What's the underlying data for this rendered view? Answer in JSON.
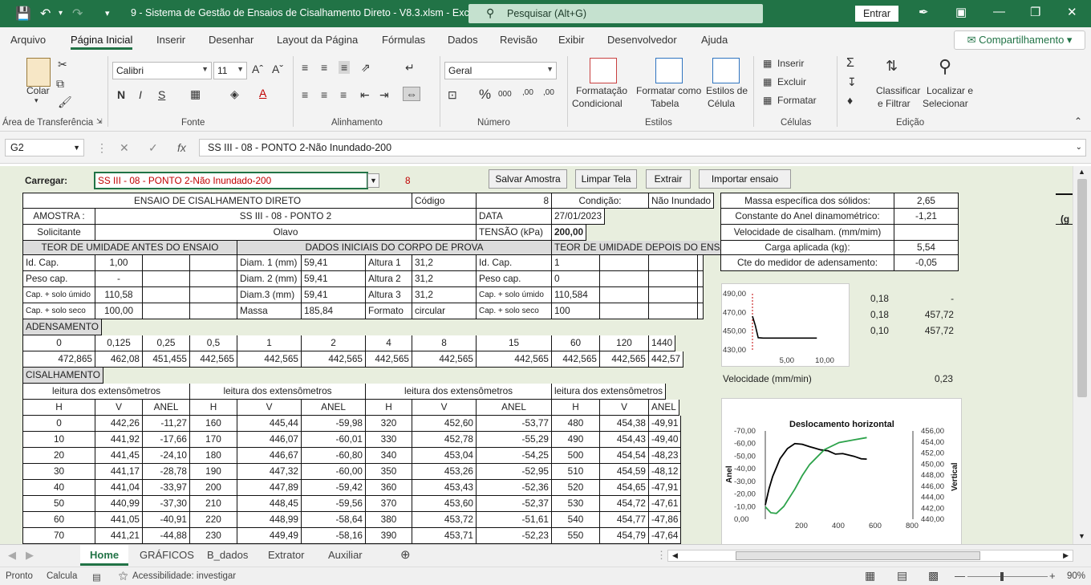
{
  "titlebar": {
    "title": "9 - Sistema de Gestão de Ensaios de Cisalhamento Direto - V8.3.xlsm  -  Excel",
    "search": "Pesquisar (Alt+G)",
    "entrar": "Entrar"
  },
  "menu": {
    "items": [
      "Arquivo",
      "Página Inicial",
      "Inserir",
      "Desenhar",
      "Layout da Página",
      "Fórmulas",
      "Dados",
      "Revisão",
      "Exibir",
      "Desenvolvedor",
      "Ajuda"
    ],
    "share": "Compartilhamento"
  },
  "ribbon": {
    "clipboard": {
      "label": "Área de Transferência",
      "colar": "Colar"
    },
    "font": {
      "label": "Fonte",
      "name": "Calibri",
      "size": "11"
    },
    "alignment": {
      "label": "Alinhamento"
    },
    "number": {
      "label": "Número",
      "format": "Geral"
    },
    "styles": {
      "label": "Estilos",
      "cond1": "Formatação",
      "cond2": "Condicional",
      "table1": "Formatar como",
      "table2": "Tabela",
      "cell1": "Estilos de",
      "cell2": "Célula"
    },
    "cells": {
      "label": "Células",
      "insert": "Inserir",
      "delete": "Excluir",
      "format": "Formatar"
    },
    "editing": {
      "label": "Edição",
      "sort1": "Classificar",
      "sort2": "e Filtrar",
      "find1": "Localizar e",
      "find2": "Selecionar"
    }
  },
  "formula_bar": {
    "name_box": "G2",
    "content": "SS III - 08 - PONTO 2-Não Inundado-200"
  },
  "sheet": {
    "carregar_label": "Carregar:",
    "carregar_value": "SS III - 08 - PONTO 2-Não Inundado-200",
    "carregar_num": "8",
    "buttons": [
      "Salvar Amostra",
      "Limpar Tela",
      "Extrair",
      "Importar ensaio"
    ],
    "header": {
      "title": "ENSAIO DE CISALHAMENTO DIRETO",
      "codigo_label": "Código",
      "codigo": "8",
      "condicao_label": "Condição:",
      "condicao": "Não Inundado",
      "amostra_label": "AMOSTRA :",
      "amostra": "SS III - 08 - PONTO 2",
      "data_label": "DATA",
      "data": "27/01/2023",
      "solicitante_label": "Solicitante",
      "solicitante": "Olavo",
      "tensao_label": "TENSÃO (kPa)",
      "tensao": "200,00"
    },
    "sections": {
      "umid_antes": "TEOR DE UMIDADE ANTES DO ENSAIO",
      "dados_iniciais": "DADOS INICIAIS DO CORPO DE PROVA",
      "umid_depois": "TEOR DE UMIDADE DEPOIS DO ENSAIO",
      "adensamento": "ADENSAMENTO",
      "cisalhamento": "CISALHAMENTO"
    },
    "umid_antes": [
      [
        "Id. Cap.",
        "1,00"
      ],
      [
        "Peso cap.",
        "-"
      ],
      [
        "Cap. + solo úmido",
        "110,58"
      ],
      [
        "Cap. + solo seco",
        "100,00"
      ]
    ],
    "dados_iniciais": [
      [
        "Diam. 1 (mm)",
        "59,41",
        "Altura 1",
        "31,2"
      ],
      [
        "Diam. 2 (mm)",
        "59,41",
        "Altura 2",
        "31,2"
      ],
      [
        "Diam.3 (mm)",
        "59,41",
        "Altura 3",
        "31,2"
      ],
      [
        "Massa",
        "185,84",
        "Formato",
        "circular"
      ]
    ],
    "umid_depois": [
      [
        "Id. Cap.",
        "1"
      ],
      [
        "Peso cap.",
        "0"
      ],
      [
        "Cap. + solo úmido",
        "110,584"
      ],
      [
        "Cap. + solo seco",
        "100"
      ]
    ],
    "adens_times": [
      "0",
      "0,125",
      "0,25",
      "0,5",
      "1",
      "2",
      "4",
      "8",
      "15",
      "60",
      "120",
      "1440"
    ],
    "adens_values": [
      "472,865",
      "462,08",
      "451,455",
      "442,565",
      "442,565",
      "442,565",
      "442,565",
      "442,565",
      "442,565",
      "442,565",
      "442,565",
      "442,57"
    ],
    "cis_group_header": "leitura dos extensômetros",
    "cis_cols": [
      "H",
      "V",
      "ANEL"
    ],
    "cis_rows": [
      [
        "0",
        "442,26",
        "-11,27",
        "160",
        "445,44",
        "-59,98",
        "320",
        "452,60",
        "-53,77",
        "480",
        "454,38",
        "-49,91"
      ],
      [
        "10",
        "441,92",
        "-17,66",
        "170",
        "446,07",
        "-60,01",
        "330",
        "452,78",
        "-55,29",
        "490",
        "454,43",
        "-49,40"
      ],
      [
        "20",
        "441,45",
        "-24,10",
        "180",
        "446,67",
        "-60,80",
        "340",
        "453,04",
        "-54,25",
        "500",
        "454,54",
        "-48,23"
      ],
      [
        "30",
        "441,17",
        "-28,78",
        "190",
        "447,32",
        "-60,00",
        "350",
        "453,26",
        "-52,95",
        "510",
        "454,59",
        "-48,12"
      ],
      [
        "40",
        "441,04",
        "-33,97",
        "200",
        "447,89",
        "-59,42",
        "360",
        "453,43",
        "-52,36",
        "520",
        "454,65",
        "-47,91"
      ],
      [
        "50",
        "440,99",
        "-37,30",
        "210",
        "448,45",
        "-59,56",
        "370",
        "453,60",
        "-52,37",
        "530",
        "454,72",
        "-47,61"
      ],
      [
        "60",
        "441,05",
        "-40,91",
        "220",
        "448,99",
        "-58,64",
        "380",
        "453,72",
        "-51,61",
        "540",
        "454,77",
        "-47,86"
      ],
      [
        "70",
        "441,21",
        "-44,88",
        "230",
        "449,49",
        "-58,16",
        "390",
        "453,71",
        "-52,23",
        "550",
        "454,79",
        "-47,64"
      ]
    ],
    "params": [
      [
        "Massa específica dos sólidos:",
        "2,65"
      ],
      [
        "Constante do Anel dinamométrico:",
        "-1,21"
      ],
      [
        "Velocidade de cisalham. (mm/mim)",
        ""
      ],
      [
        "Carga aplicada (kg):",
        "5,54"
      ],
      [
        "Cte do medidor de adensamento:",
        "-0,05"
      ]
    ],
    "side_values": [
      [
        "0,18",
        "-"
      ],
      [
        "0,18",
        "457,72"
      ],
      [
        "0,10",
        "457,72"
      ]
    ],
    "velocidade_label": "Velocidade (mm/min)",
    "velocidade": "0,23",
    "edge_text": "(g"
  },
  "chart_data": [
    {
      "type": "line",
      "x_ticks": [
        "5,00",
        "10,00"
      ],
      "y_ticks": [
        "490,00",
        "470,00",
        "450,00",
        "430,00"
      ],
      "ylim": [
        430,
        490
      ],
      "xlim": [
        0,
        12
      ],
      "series": [
        {
          "values": [
            [
              0,
              466
            ],
            [
              0.4,
              456
            ],
            [
              0.8,
              443
            ],
            [
              1.5,
              442.6
            ],
            [
              3,
              442.6
            ],
            [
              6,
              442.6
            ],
            [
              9,
              442.6
            ]
          ]
        }
      ],
      "color": "#000000"
    },
    {
      "type": "line",
      "title": "Deslocamento horizontal",
      "ylabel": "Anel",
      "y2label": "Vertical",
      "y_ticks": [
        "-70,00",
        "-60,00",
        "-50,00",
        "-40,00",
        "-30,00",
        "-20,00",
        "-10,00",
        "0,00"
      ],
      "y2_ticks": [
        "456,00",
        "454,00",
        "452,00",
        "450,00",
        "448,00",
        "446,00",
        "444,00",
        "442,00",
        "440,00"
      ],
      "x_ticks": [
        "200",
        "400",
        "600",
        "800"
      ],
      "series": [
        {
          "color": "#000000",
          "axis": "anel",
          "values": [
            [
              0,
              -11.27
            ],
            [
              20,
              -24.1
            ],
            [
              40,
              -33.97
            ],
            [
              60,
              -40.91
            ],
            [
              80,
              -48
            ],
            [
              120,
              -56
            ],
            [
              160,
              -59.98
            ],
            [
              200,
              -59.42
            ],
            [
              240,
              -57.5
            ],
            [
              300,
              -55
            ],
            [
              340,
              -54.25
            ],
            [
              380,
              -51.61
            ],
            [
              420,
              -52
            ],
            [
              480,
              -49.91
            ],
            [
              520,
              -47.91
            ],
            [
              550,
              -47.64
            ]
          ]
        },
        {
          "color": "#2ca24a",
          "axis": "vertical",
          "values": [
            [
              0,
              442.26
            ],
            [
              30,
              441.17
            ],
            [
              60,
              441.05
            ],
            [
              100,
              442.3
            ],
            [
              160,
              445.44
            ],
            [
              200,
              447.89
            ],
            [
              240,
              449.9
            ],
            [
              320,
              452.6
            ],
            [
              400,
              453.9
            ],
            [
              480,
              454.38
            ],
            [
              550,
              454.79
            ]
          ]
        }
      ]
    }
  ],
  "tabs": {
    "items": [
      "Home",
      "GRÁFICOS",
      "B_dados",
      "Extrator",
      "Auxiliar"
    ],
    "active": "Home"
  },
  "status": {
    "ready": "Pronto",
    "calc": "Calcula",
    "accessibility": "Acessibilidade: investigar",
    "zoom": "90%"
  },
  "colors": {
    "excel_green": "#217346",
    "sheet_bg": "#e8eede",
    "red_text": "#c00000"
  }
}
